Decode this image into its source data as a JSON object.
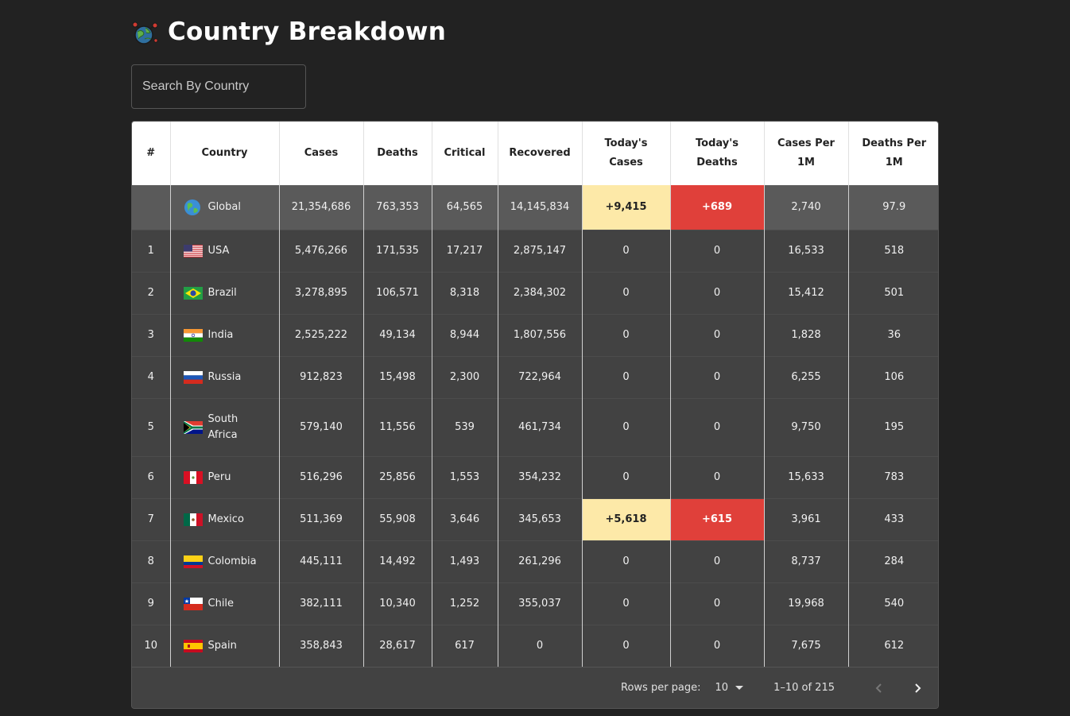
{
  "page": {
    "title": "Country Breakdown"
  },
  "search": {
    "placeholder": "Search By Country"
  },
  "table": {
    "headers": {
      "rank": "#",
      "country": "Country",
      "cases": "Cases",
      "deaths": "Deaths",
      "critical": "Critical",
      "recovered": "Recovered",
      "today_cases": "Today's Cases",
      "today_deaths": "Today's Deaths",
      "cases_per_1m": "Cases Per 1M",
      "deaths_per_1m": "Deaths Per 1M"
    },
    "rows": [
      {
        "rank": "",
        "country": "Global",
        "flag": "globe-icon",
        "cases": "21,354,686",
        "deaths": "763,353",
        "critical": "64,565",
        "recovered": "14,145,834",
        "today_cases": "+9,415",
        "today_deaths": "+689",
        "cases_per_1m": "2,740",
        "deaths_per_1m": "97.9"
      },
      {
        "rank": "1",
        "country": "USA",
        "flag": "usa-flag-icon",
        "cases": "5,476,266",
        "deaths": "171,535",
        "critical": "17,217",
        "recovered": "2,875,147",
        "today_cases": "0",
        "today_deaths": "0",
        "cases_per_1m": "16,533",
        "deaths_per_1m": "518"
      },
      {
        "rank": "2",
        "country": "Brazil",
        "flag": "brazil-flag-icon",
        "cases": "3,278,895",
        "deaths": "106,571",
        "critical": "8,318",
        "recovered": "2,384,302",
        "today_cases": "0",
        "today_deaths": "0",
        "cases_per_1m": "15,412",
        "deaths_per_1m": "501"
      },
      {
        "rank": "3",
        "country": "India",
        "flag": "india-flag-icon",
        "cases": "2,525,222",
        "deaths": "49,134",
        "critical": "8,944",
        "recovered": "1,807,556",
        "today_cases": "0",
        "today_deaths": "0",
        "cases_per_1m": "1,828",
        "deaths_per_1m": "36"
      },
      {
        "rank": "4",
        "country": "Russia",
        "flag": "russia-flag-icon",
        "cases": "912,823",
        "deaths": "15,498",
        "critical": "2,300",
        "recovered": "722,964",
        "today_cases": "0",
        "today_deaths": "0",
        "cases_per_1m": "6,255",
        "deaths_per_1m": "106"
      },
      {
        "rank": "5",
        "country": "South Africa",
        "flag": "south-africa-flag-icon",
        "cases": "579,140",
        "deaths": "11,556",
        "critical": "539",
        "recovered": "461,734",
        "today_cases": "0",
        "today_deaths": "0",
        "cases_per_1m": "9,750",
        "deaths_per_1m": "195"
      },
      {
        "rank": "6",
        "country": "Peru",
        "flag": "peru-flag-icon",
        "cases": "516,296",
        "deaths": "25,856",
        "critical": "1,553",
        "recovered": "354,232",
        "today_cases": "0",
        "today_deaths": "0",
        "cases_per_1m": "15,633",
        "deaths_per_1m": "783"
      },
      {
        "rank": "7",
        "country": "Mexico",
        "flag": "mexico-flag-icon",
        "cases": "511,369",
        "deaths": "55,908",
        "critical": "3,646",
        "recovered": "345,653",
        "today_cases": "+5,618",
        "today_deaths": "+615",
        "cases_per_1m": "3,961",
        "deaths_per_1m": "433"
      },
      {
        "rank": "8",
        "country": "Colombia",
        "flag": "colombia-flag-icon",
        "cases": "445,111",
        "deaths": "14,492",
        "critical": "1,493",
        "recovered": "261,296",
        "today_cases": "0",
        "today_deaths": "0",
        "cases_per_1m": "8,737",
        "deaths_per_1m": "284"
      },
      {
        "rank": "9",
        "country": "Chile",
        "flag": "chile-flag-icon",
        "cases": "382,111",
        "deaths": "10,340",
        "critical": "1,252",
        "recovered": "355,037",
        "today_cases": "0",
        "today_deaths": "0",
        "cases_per_1m": "19,968",
        "deaths_per_1m": "540"
      },
      {
        "rank": "10",
        "country": "Spain",
        "flag": "spain-flag-icon",
        "cases": "358,843",
        "deaths": "28,617",
        "critical": "617",
        "recovered": "0",
        "today_cases": "0",
        "today_deaths": "0",
        "cases_per_1m": "7,675",
        "deaths_per_1m": "612"
      }
    ]
  },
  "pagination": {
    "rows_per_page_label": "Rows per page:",
    "rows_per_page_value": "10",
    "range": "1–10 of 215"
  },
  "colors": {
    "background": "#222222",
    "panel": "#424242",
    "highlight_cases": "#fde9a8",
    "highlight_deaths": "#e0403a"
  }
}
